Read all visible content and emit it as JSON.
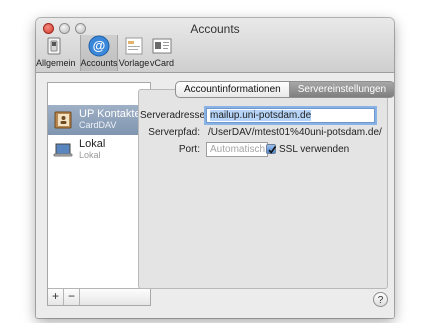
{
  "window": {
    "title": "Accounts"
  },
  "toolbar": {
    "items": [
      {
        "label": "Allgemein",
        "icon": "switch-icon"
      },
      {
        "label": "Accounts",
        "icon": "at-icon"
      },
      {
        "label": "Vorlage",
        "icon": "template-icon"
      },
      {
        "label": "vCard",
        "icon": "vcard-icon"
      }
    ],
    "active": "Accounts"
  },
  "sidebar": {
    "accounts": [
      {
        "name": "UP Kontakte",
        "type": "CardDAV",
        "selected": true,
        "icon": "contacts-book-icon"
      },
      {
        "name": "Lokal",
        "type": "Lokal",
        "selected": false,
        "icon": "laptop-icon"
      }
    ],
    "add_label": "+",
    "remove_label": "−"
  },
  "tabs": [
    {
      "label": "Accountinformationen",
      "active": false
    },
    {
      "label": "Servereinstellungen",
      "active": true
    }
  ],
  "server_settings": {
    "server_address_label": "Serveradresse:",
    "server_address_value": "mailup.uni-potsdam.de",
    "server_path_label": "Serverpfad:",
    "server_path_value": "/UserDAV/mtest01%40uni-potsdam.de/",
    "port_label": "Port:",
    "port_placeholder": "Automatisch",
    "ssl_label": "SSL verwenden",
    "ssl_checked": true
  },
  "help_label": "?",
  "colors": {
    "selection": "#8599b3",
    "active_tab": "#8a8a8a",
    "focus_ring": "#8ab3e5",
    "close_button": "#d23a2d"
  }
}
